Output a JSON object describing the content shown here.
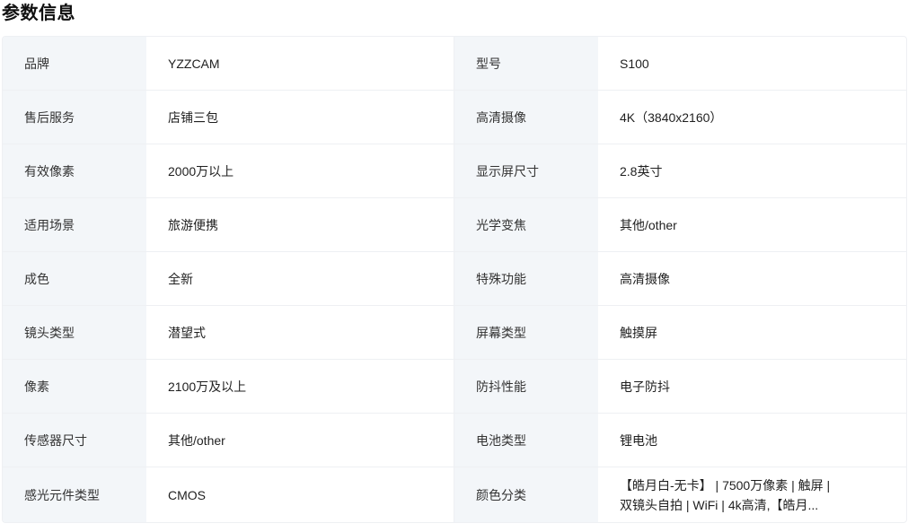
{
  "section_title": "参数信息",
  "rows": [
    {
      "l1": "品牌",
      "v1": "YZZCAM",
      "l2": "型号",
      "v2": "S100"
    },
    {
      "l1": "售后服务",
      "v1": "店铺三包",
      "l2": "高清摄像",
      "v2": "4K（3840x2160）"
    },
    {
      "l1": "有效像素",
      "v1": "2000万以上",
      "l2": "显示屏尺寸",
      "v2": "2.8英寸"
    },
    {
      "l1": "适用场景",
      "v1": "旅游便携",
      "l2": "光学变焦",
      "v2": "其他/other"
    },
    {
      "l1": "成色",
      "v1": "全新",
      "l2": "特殊功能",
      "v2": "高清摄像"
    },
    {
      "l1": "镜头类型",
      "v1": "潜望式",
      "l2": "屏幕类型",
      "v2": "触摸屏"
    },
    {
      "l1": "像素",
      "v1": "2100万及以上",
      "l2": "防抖性能",
      "v2": "电子防抖"
    },
    {
      "l1": "传感器尺寸",
      "v1": "其他/other",
      "l2": "电池类型",
      "v2": "锂电池"
    },
    {
      "l1": "感光元件类型",
      "v1": "CMOS",
      "l2": "颜色分类",
      "v2_line1": "【皓月白-无卡】 | 7500万像素 | 触屏 |",
      "v2_line2": "双镜头自拍 | WiFi | 4k高清,【皓月..."
    }
  ]
}
